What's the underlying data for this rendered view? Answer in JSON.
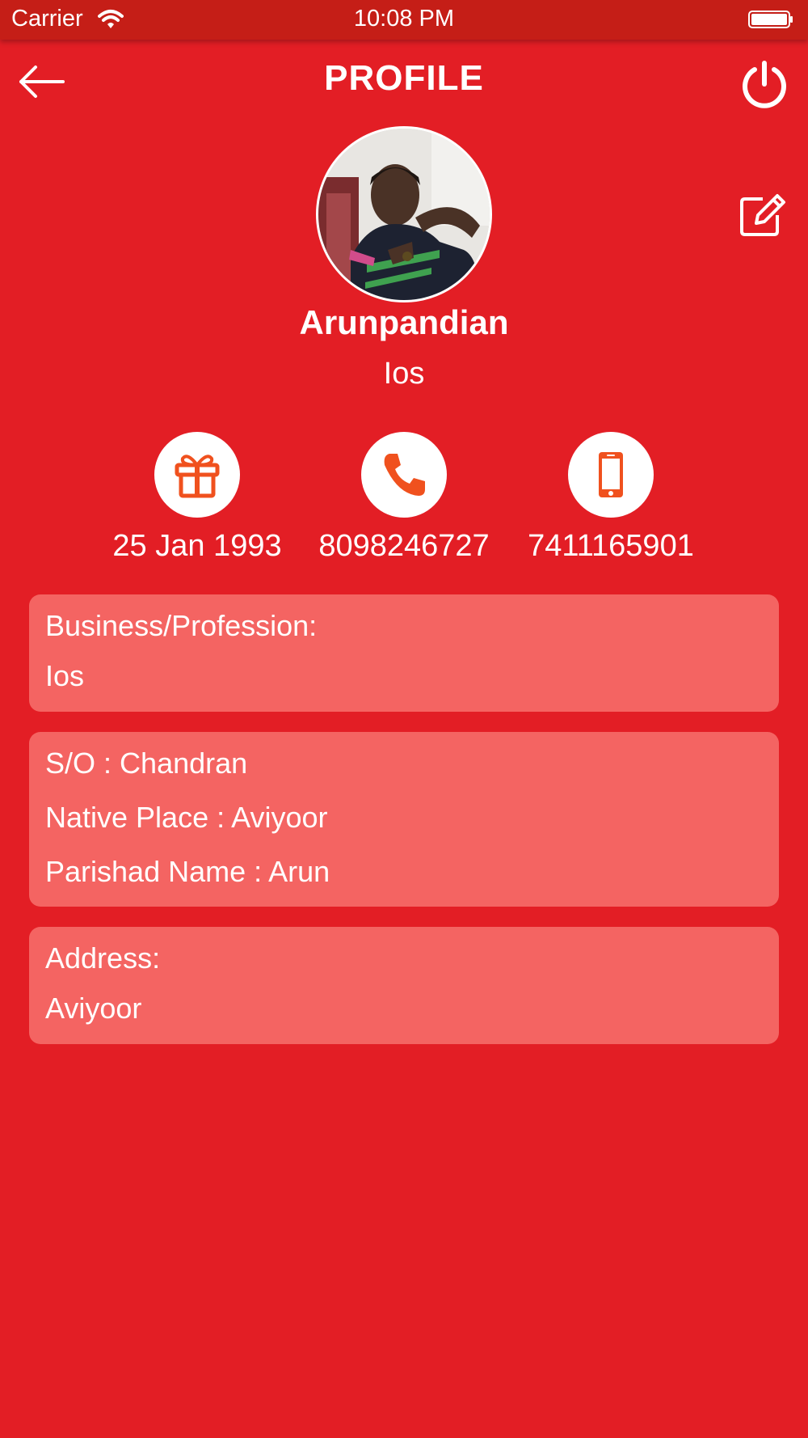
{
  "status_bar": {
    "carrier": "Carrier",
    "time": "10:08 PM"
  },
  "header": {
    "title": "PROFILE",
    "back_icon": "arrow-left-icon",
    "power_icon": "power-icon",
    "edit_icon": "edit-icon"
  },
  "profile": {
    "name": "Arunpandian",
    "subtitle": "Ios"
  },
  "contact": {
    "birthday": "25 Jan 1993",
    "phone": "8098246727",
    "mobile": "7411165901",
    "birthday_icon": "gift-icon",
    "phone_icon": "phone-icon",
    "mobile_icon": "mobile-icon"
  },
  "business": {
    "label": "Business/Profession:",
    "value": "Ios"
  },
  "family": {
    "so_label": "S/O :",
    "so_value": "Chandran",
    "native_label": "Native Place :",
    "native_value": "Aviyoor",
    "parishad_label": "Parishad Name :",
    "parishad_value": "Arun"
  },
  "address": {
    "label": "Address:",
    "value": "Aviyoor"
  },
  "colors": {
    "background": "#e31e25",
    "status_bar": "#c51e17",
    "card": "#f46462",
    "icon_accent": "#f0511e",
    "text": "#ffffff"
  }
}
